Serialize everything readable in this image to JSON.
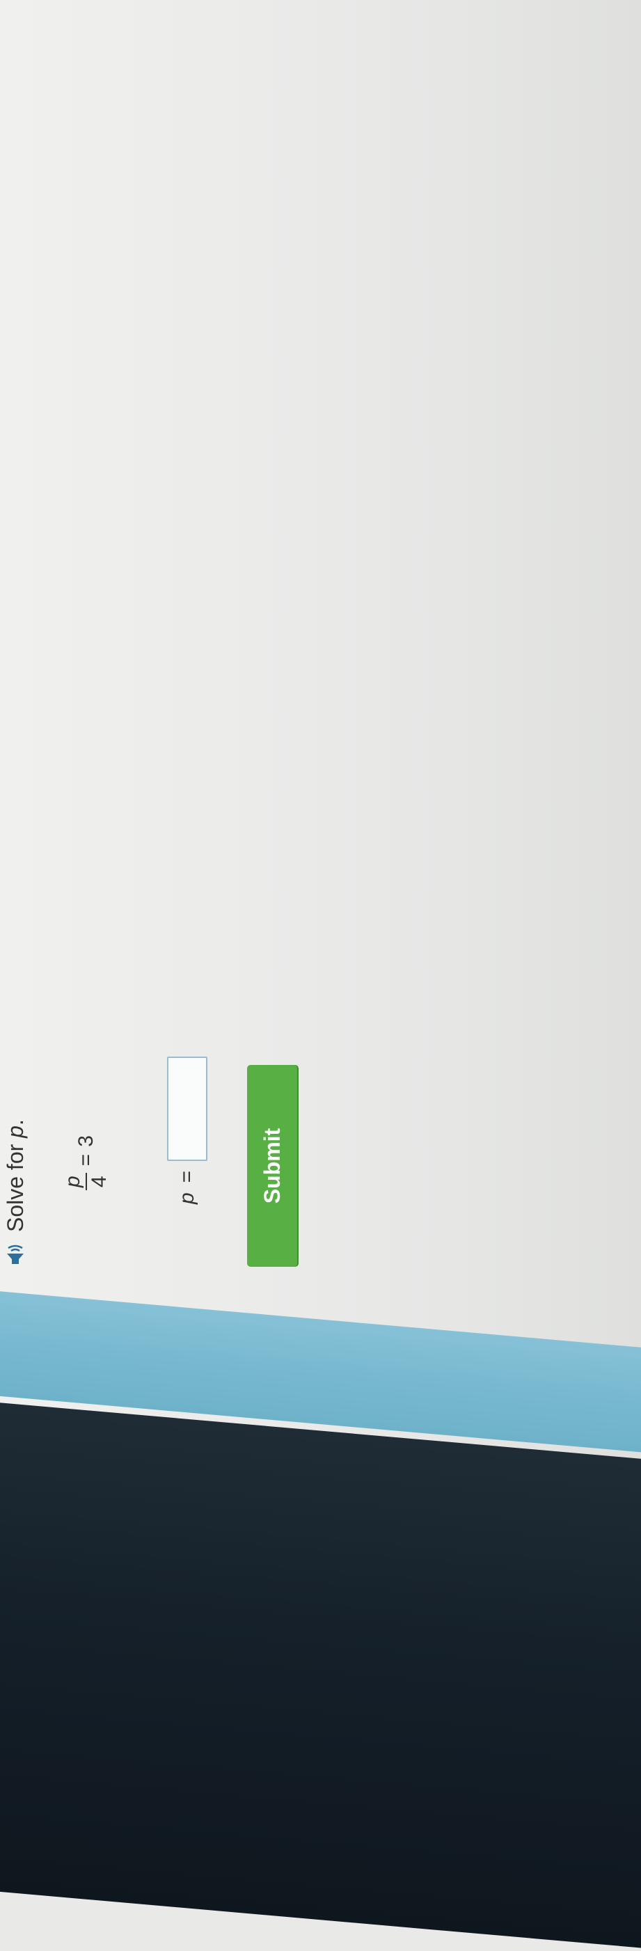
{
  "question": {
    "speaker_icon": "speaker-icon",
    "instruction_prefix": "Solve for ",
    "instruction_var": "p",
    "instruction_suffix": "."
  },
  "equation": {
    "numerator": "p",
    "denominator": "4",
    "operator": "=",
    "rhs": "3"
  },
  "answer": {
    "variable": "p",
    "equals": "=",
    "value": "",
    "placeholder": ""
  },
  "submit": {
    "label": "Submit"
  },
  "colors": {
    "submit_button": "#58b045",
    "accent_band": "#77b8cf",
    "input_border": "#9bbbd0"
  }
}
